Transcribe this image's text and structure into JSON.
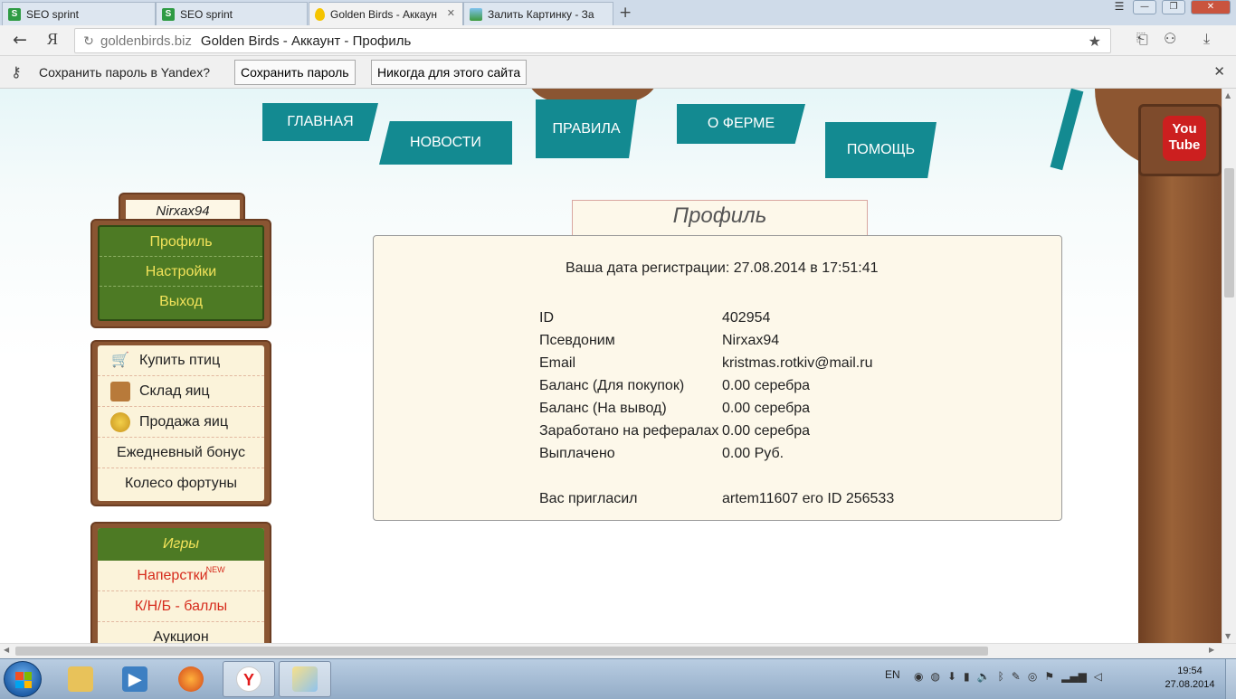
{
  "browser": {
    "tabs": [
      {
        "title": "SEO sprint",
        "icon": "seo-sprint-favicon"
      },
      {
        "title": "SEO sprint",
        "icon": "seo-sprint-favicon"
      },
      {
        "title": "Golden Birds - Аккаун",
        "icon": "golden-egg-favicon",
        "active": true
      },
      {
        "title": "Залить Картинку - За",
        "icon": "image-favicon"
      }
    ],
    "tab_close": "✕",
    "new_tab": "+",
    "address": {
      "host": "goldenbirds.biz",
      "title": "Golden Birds - Аккаунт - Профиль"
    },
    "yandex_letter": "Я"
  },
  "password_bar": {
    "prompt": "Сохранить пароль в Yandex?",
    "save_label": "Сохранить пароль",
    "never_label": "Никогда для этого сайта",
    "close": "✕"
  },
  "site": {
    "nav": [
      "ГЛАВНАЯ",
      "НОВОСТИ",
      "ПРАВИЛА",
      "О ФЕРМЕ",
      "ПОМОЩЬ"
    ],
    "youtube": {
      "line1": "You",
      "line2": "Tube"
    },
    "user": {
      "name": "Nirxax94",
      "menu": [
        "Профиль",
        "Настройки",
        "Выход"
      ]
    },
    "shop_menu": [
      {
        "label": "Купить птиц",
        "icon": "cart-icon"
      },
      {
        "label": "Склад яиц",
        "icon": "box-icon"
      },
      {
        "label": "Продажа яиц",
        "icon": "coins-icon"
      },
      {
        "label": "Ежедневный бонус"
      },
      {
        "label": "Колесо фортуны"
      }
    ],
    "games": {
      "title": "Игры",
      "items": [
        {
          "label": "Наперстки",
          "badge": "NEW"
        },
        {
          "label": "К/Н/Б - баллы"
        },
        {
          "label": "Аукцион"
        }
      ]
    },
    "profile": {
      "title": "Профиль",
      "registration": "Ваша дата регистрации: 27.08.2014 в 17:51:41",
      "rows": [
        {
          "key": "ID",
          "value": "402954"
        },
        {
          "key": "Псевдоним",
          "value": "Nirxax94"
        },
        {
          "key": "Email",
          "value": "kristmas.rotkiv@mail.ru"
        },
        {
          "key": "Баланс (Для покупок)",
          "value": "0.00 серебра"
        },
        {
          "key": "Баланс (На вывод)",
          "value": "0.00 серебра"
        },
        {
          "key": "Заработано на рефералах",
          "value": "0.00 серебра"
        },
        {
          "key": "Выплачено",
          "value": "0.00 Руб."
        }
      ],
      "invited": {
        "key": "Вас пригласил",
        "value": "artem11607 его ID 256533"
      }
    }
  },
  "taskbar": {
    "language": "EN",
    "time": "19:54",
    "date": "27.08.2014"
  },
  "colors": {
    "nav_teal": "#138a91",
    "menu_green": "#4d7a24",
    "menu_yellow": "#f2e35a",
    "wood": "#8a5532",
    "cream": "#fdf8ea",
    "red_link": "#d62b1c"
  }
}
